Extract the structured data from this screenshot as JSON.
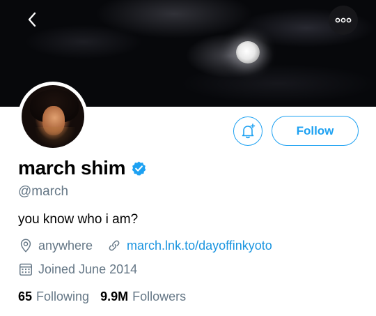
{
  "header": {
    "back_icon": "chevron-left-icon",
    "more_icon": "more-horizontal-icon"
  },
  "profile": {
    "display_name": "march shim",
    "verified": true,
    "handle": "@march",
    "bio": "you know who i am?",
    "location": "anywhere",
    "website": "march.lnk.to/dayoffinkyoto",
    "joined": "Joined June 2014"
  },
  "actions": {
    "notify_icon": "bell-plus-icon",
    "follow_label": "Follow"
  },
  "stats": {
    "following_count": "65",
    "following_label": "Following",
    "followers_count": "9.9M",
    "followers_label": "Followers"
  },
  "colors": {
    "accent": "#1da1f2",
    "link": "#1b95e0",
    "secondary_text": "#657786",
    "verified_badge": "#1da1f2"
  }
}
